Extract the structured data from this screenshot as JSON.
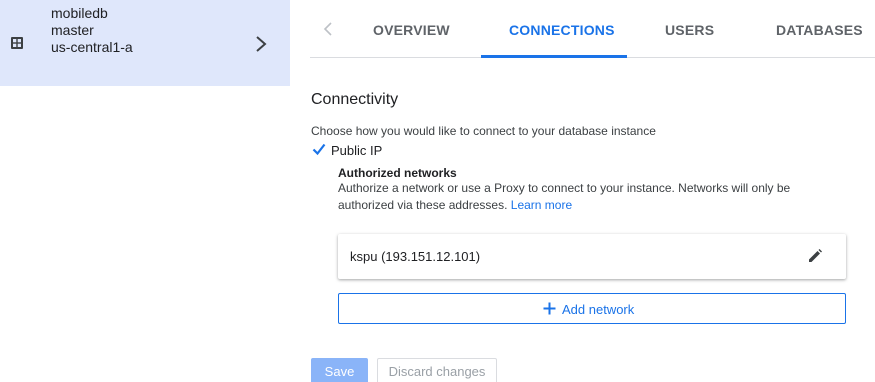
{
  "colors": {
    "accent": "#1a73e8",
    "sidebar_selected_bg": "#dfe7fb",
    "save_disabled_bg": "#8ab4f8"
  },
  "sidebar": {
    "instance": {
      "icon": "database-grid-icon",
      "lines": [
        "mobiledb",
        "master",
        "us-central1-a"
      ],
      "expand_icon": "chevron-right-icon"
    }
  },
  "tabs": {
    "prev_icon": "chevron-left-icon",
    "items": [
      {
        "label": "OVERVIEW",
        "active": false
      },
      {
        "label": "CONNECTIONS",
        "active": true
      },
      {
        "label": "USERS",
        "active": false
      },
      {
        "label": "DATABASES",
        "active": false
      }
    ]
  },
  "connectivity": {
    "title": "Connectivity",
    "description": "Choose how you would like to connect to your database instance",
    "public_ip": {
      "label": "Public IP",
      "checked": true
    },
    "authorized_networks": {
      "title": "Authorized networks",
      "description": "Authorize a network or use a Proxy to connect to your instance. Networks will only be authorized via these addresses.",
      "learn_more": "Learn more",
      "networks": [
        {
          "name": "kspu (193.151.12.101)",
          "icon": "edit-pencil-icon"
        }
      ],
      "add_button": "Add network"
    }
  },
  "footer": {
    "save": "Save",
    "discard": "Discard changes"
  }
}
